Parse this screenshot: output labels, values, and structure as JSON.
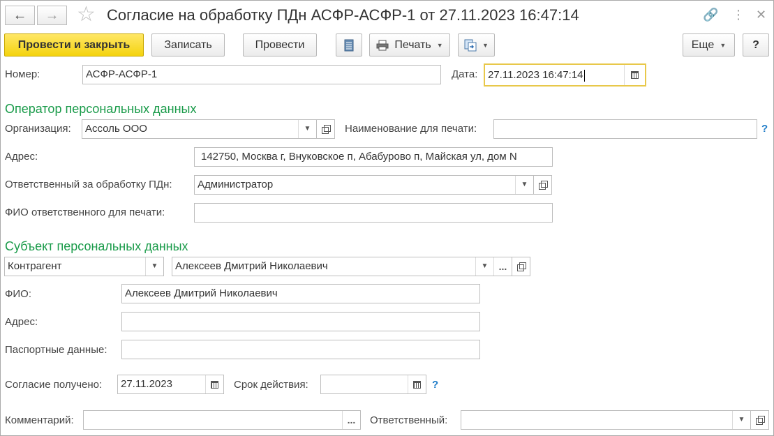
{
  "window": {
    "title": "Согласие на обработку ПДн АСФР-АСФР-1 от 27.11.2023 16:47:14",
    "icons": [
      "arrow-left-icon",
      "arrow-right-icon",
      "star-icon",
      "link-icon",
      "more-icon",
      "close-icon"
    ]
  },
  "toolbar": {
    "post_and_close": "Провести и закрыть",
    "save": "Записать",
    "post": "Провести",
    "print": "Печать",
    "more": "Еще",
    "help": "?"
  },
  "header": {
    "number_label": "Номер:",
    "number_value": "АСФР-АСФР-1",
    "date_label": "Дата:",
    "date_value": "27.11.2023 16:47:14"
  },
  "operator": {
    "section_title": "Оператор персональных данных",
    "org_label": "Организация:",
    "org_value": "Ассоль ООО",
    "print_name_label": "Наименование для печати:",
    "print_name_value": "",
    "address_label": "Адрес:",
    "address_value": "142750, Москва г, Внуковское п, Абабурово п, Майская ул, дом N",
    "responsible_label": "Ответственный за обработку ПДн:",
    "responsible_value": "Администратор",
    "responsible_print_label": "ФИО ответственного для печати:",
    "responsible_print_value": ""
  },
  "subject": {
    "section_title": "Субъект персональных данных",
    "type_value": "Контрагент",
    "subject_value": "Алексеев Дмитрий Николаевич",
    "fio_label": "ФИО:",
    "fio_value": "Алексеев Дмитрий Николаевич",
    "address_label": "Адрес:",
    "address_value": "",
    "passport_label": "Паспортные данные:",
    "passport_value": ""
  },
  "consent": {
    "received_label": "Согласие получено:",
    "received_value": "27.11.2023",
    "validity_label": "Срок действия:",
    "validity_value": "  .  ."
  },
  "footer": {
    "comment_label": "Комментарий:",
    "comment_value": "",
    "responsible_label": "Ответственный:",
    "responsible_value": "",
    "ellipsis": "..."
  },
  "help_mark": "?"
}
